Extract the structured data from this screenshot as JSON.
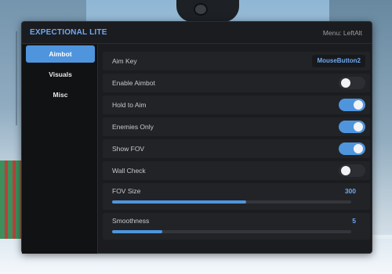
{
  "window": {
    "title": "EXPECTIONAL LITE",
    "menu_hint": "Menu: LeftAlt",
    "accent_color": "#4f95dd"
  },
  "sidebar": {
    "tabs": [
      {
        "label": "Aimbot",
        "active": true
      },
      {
        "label": "Visuals",
        "active": false
      },
      {
        "label": "Misc",
        "active": false
      }
    ]
  },
  "aimbot": {
    "aim_key": {
      "label": "Aim Key",
      "value": "MouseButton2"
    },
    "toggles": [
      {
        "label": "Enable Aimbot",
        "on": false
      },
      {
        "label": "Hold to Aim",
        "on": true
      },
      {
        "label": "Enemies Only",
        "on": true
      },
      {
        "label": "Show FOV",
        "on": true
      },
      {
        "label": "Wall Check",
        "on": false
      }
    ],
    "sliders": [
      {
        "label": "FOV Size",
        "value": "300",
        "fill_fraction": 0.56
      },
      {
        "label": "Smoothness",
        "value": "5",
        "fill_fraction": 0.21
      }
    ]
  }
}
